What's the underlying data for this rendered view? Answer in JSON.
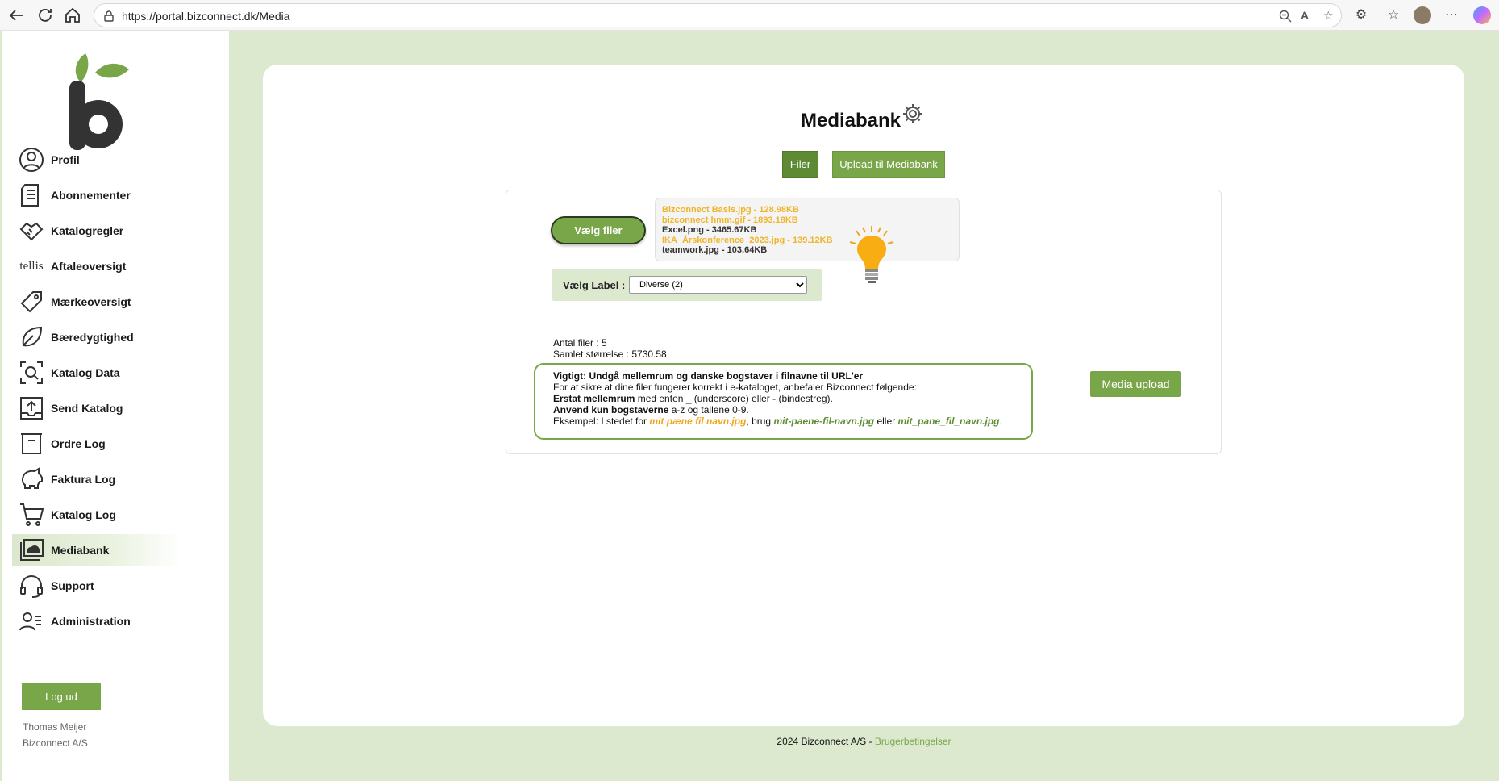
{
  "browser": {
    "url": "https://portal.bizconnect.dk/Media"
  },
  "sidebar": {
    "items": [
      {
        "label": "Profil",
        "icon": "user-circle-icon"
      },
      {
        "label": "Abonnementer",
        "icon": "document-icon"
      },
      {
        "label": "Katalogregler",
        "icon": "handshake-icon"
      },
      {
        "label": "Aftaleoversigt",
        "icon": "tellis-logo"
      },
      {
        "label": "Mærkeoversigt",
        "icon": "tag-icon"
      },
      {
        "label": "Bæredygtighed",
        "icon": "leaf-icon"
      },
      {
        "label": "Katalog Data",
        "icon": "search-frame-icon"
      },
      {
        "label": "Send Katalog",
        "icon": "upload-tray-icon"
      },
      {
        "label": "Ordre Log",
        "icon": "archive-box-icon"
      },
      {
        "label": "Faktura Log",
        "icon": "piggy-bank-icon"
      },
      {
        "label": "Katalog Log",
        "icon": "cart-icon"
      },
      {
        "label": "Mediabank",
        "icon": "media-folder-icon"
      },
      {
        "label": "Support",
        "icon": "headset-icon"
      },
      {
        "label": "Administration",
        "icon": "users-icon"
      }
    ],
    "tellis_text": "tellis",
    "logout_label": "Log ud",
    "user_name": "Thomas Meijer",
    "company": "Bizconnect A/S"
  },
  "main": {
    "title": "Mediabank",
    "tabs": {
      "files": "Filer",
      "upload": "Upload til Mediabank"
    },
    "choose_files_label": "Vælg filer",
    "files": [
      {
        "text": "Bizconnect Basis.jpg - 128.98KB",
        "color": "#f0b429"
      },
      {
        "text": "bizconnect hmm.gif - 1893.18KB",
        "color": "#f0b429"
      },
      {
        "text": "Excel.png - 3465.67KB",
        "color": "#333333"
      },
      {
        "text": "IKA_Årskonference_2023.jpg - 139.12KB",
        "color": "#f0b429"
      },
      {
        "text": "teamwork.jpg - 103.64KB",
        "color": "#333333"
      }
    ],
    "label_caption": "Vælg Label :",
    "label_selected": "Diverse (2)",
    "file_count": "Antal filer : 5",
    "total_size": "Samlet størrelse : 5730.58",
    "info": {
      "heading": "Vigtigt: Undgå mellemrum og danske bogstaver i filnavne til URL'er",
      "line1": "For at sikre at dine filer fungerer korrekt i e-kataloget, anbefaler Bizconnect følgende:",
      "line2_bold": "Erstat mellemrum",
      "line2_rest": " med enten _ (underscore) eller - (bindestreg).",
      "line3_bold": "Anvend kun bogstaverne",
      "line3_rest": " a-z og tallene 0-9.",
      "line4_a": "Eksempel: I stedet for ",
      "line4_bad": "mit pæne fil navn.jpg",
      "line4_b": ", brug ",
      "line4_good1": "mit-paene-fil-navn.jpg",
      "line4_c": " eller ",
      "line4_good2": "mit_pane_fil_navn.jpg",
      "line4_d": "."
    },
    "media_upload_label": "Media upload"
  },
  "footer": {
    "text": "2024 Bizconnect A/S - ",
    "link": "Brugerbetingelser"
  },
  "colors": {
    "accent": "#7aa64a",
    "accent_dark": "#5e8a33",
    "background": "#dde9cf",
    "highlight_orange": "#f0a61e"
  }
}
